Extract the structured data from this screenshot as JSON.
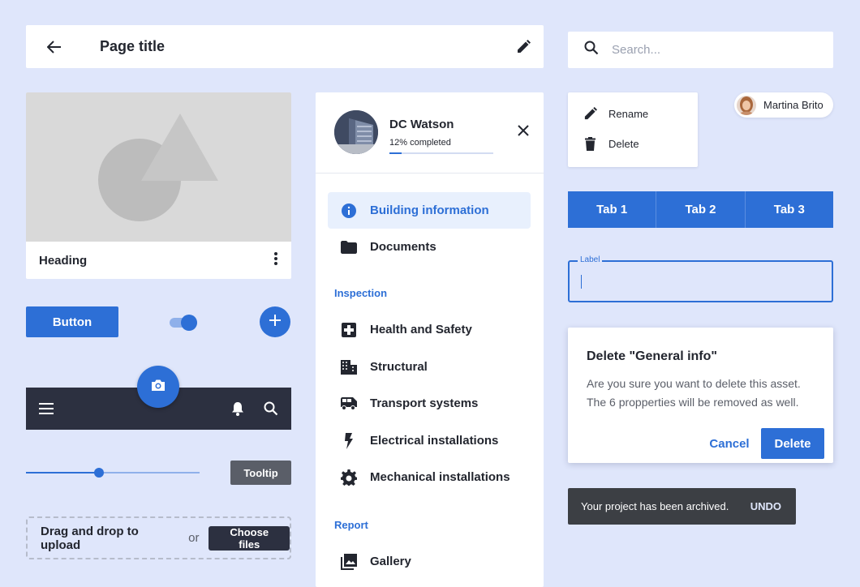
{
  "topbar": {
    "title": "Page title"
  },
  "search": {
    "placeholder": "Search..."
  },
  "image_card": {
    "heading": "Heading"
  },
  "controls": {
    "button_label": "Button",
    "toggle_on": true
  },
  "slider": {
    "value": 0.42
  },
  "tooltip": {
    "text": "Tooltip"
  },
  "upload": {
    "drag_text": "Drag and drop to upload",
    "or_text": "or",
    "choose_label": "Choose files"
  },
  "panel": {
    "user_name": "DC Watson",
    "progress_label": "12% completed",
    "progress": 0.12,
    "items": [
      {
        "label": "Building information",
        "icon": "info-icon",
        "active": true
      },
      {
        "label": "Documents",
        "icon": "folder-icon"
      }
    ],
    "sections": [
      {
        "label": "Inspection",
        "items": [
          {
            "label": "Health and Safety",
            "icon": "first-aid-icon"
          },
          {
            "label": "Structural",
            "icon": "building-icon"
          },
          {
            "label": "Transport systems",
            "icon": "bus-icon"
          },
          {
            "label": "Electrical installations",
            "icon": "bolt-icon"
          },
          {
            "label": "Mechanical installations",
            "icon": "gear-icon"
          }
        ]
      },
      {
        "label": "Report",
        "items": [
          {
            "label": "Gallery",
            "icon": "gallery-icon"
          }
        ]
      }
    ]
  },
  "menu": {
    "rename_label": "Rename",
    "delete_label": "Delete"
  },
  "chip": {
    "name": "Martina Brito"
  },
  "tabs": [
    "Tab 1",
    "Tab 2",
    "Tab 3"
  ],
  "textfield": {
    "label": "Label",
    "value": ""
  },
  "dialog": {
    "title": "Delete \"General info\"",
    "body": "Are you sure you want to delete this asset. The 6 propperties will be removed as well.",
    "cancel_label": "Cancel",
    "confirm_label": "Delete"
  },
  "snackbar": {
    "message": "Your project has been archived.",
    "action_label": "UNDO"
  },
  "colors": {
    "primary": "#2d6fd6",
    "background": "#dfe6fb",
    "dark": "#2c3040"
  }
}
